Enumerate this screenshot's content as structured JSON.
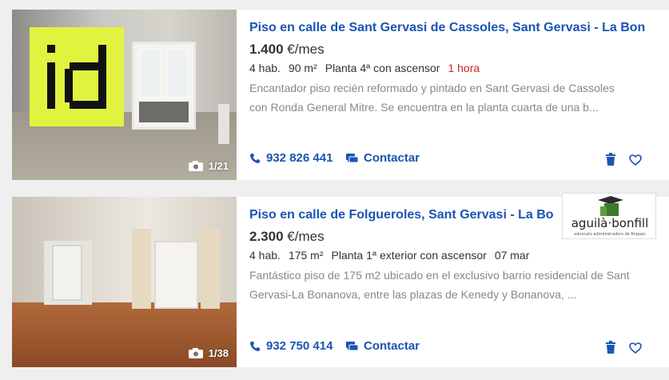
{
  "listings": [
    {
      "title": "Piso en calle de Sant Gervasi de Cassoles, Sant Gervasi - La Bona...",
      "price": "1.400",
      "price_unit": "€/mes",
      "rooms": "4 hab.",
      "size": "90 m²",
      "floor": "Planta 4ª con ascensor",
      "time": "1 hora",
      "description": "Encantador piso recién reformado y pintado en Sant Gervasi de Cassoles con Ronda General Mitre. Se encuentra en la planta cuarta de una b...",
      "phone": "932 826 441",
      "contact_label": "Contactar",
      "photo_counter": "1/21",
      "logo_text": "id"
    },
    {
      "title": "Piso en calle de Folgueroles, Sant Gervasi - La Bo...",
      "price": "2.300",
      "price_unit": "€/mes",
      "rooms": "4 hab.",
      "size": "175 m²",
      "floor": "Planta 1ª exterior con ascensor",
      "time": "07 mar",
      "description": "Fantástico piso de 175 m2 ubicado en el exclusivo barrio residencial de Sant Gervasi-La Bonanova, entre las plazas de Kenedy y Bonanova, ...",
      "phone": "932 750 414",
      "contact_label": "Contactar",
      "photo_counter": "1/38",
      "agency_name": "aguilà·bonfill",
      "agency_tagline": "advocats administradors de finques"
    }
  ],
  "colors": {
    "link": "#1a54b3",
    "time_recent": "#d22222",
    "logo_bg": "#e1f33f"
  }
}
